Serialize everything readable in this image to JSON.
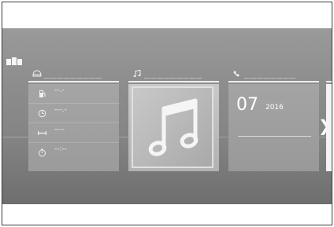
{
  "panels": {
    "vehicle": {
      "header_title": "_________",
      "rows": [
        {
          "icon": "fuel-icon",
          "value": "--.-"
        },
        {
          "icon": "speed-icon",
          "value": "---.-"
        },
        {
          "icon": "range-icon",
          "value": "----"
        },
        {
          "icon": "timer-icon",
          "value": "--:--"
        }
      ]
    },
    "audio": {
      "header_title": "_________",
      "art_icon": "music-note-icon"
    },
    "phone": {
      "header_title": "________",
      "date_day": "07",
      "date_year": "2016"
    },
    "next": {
      "icon": "chevron-right-icon"
    }
  },
  "colors": {
    "text": "#ffffff",
    "screen": "#8c8c8c"
  }
}
